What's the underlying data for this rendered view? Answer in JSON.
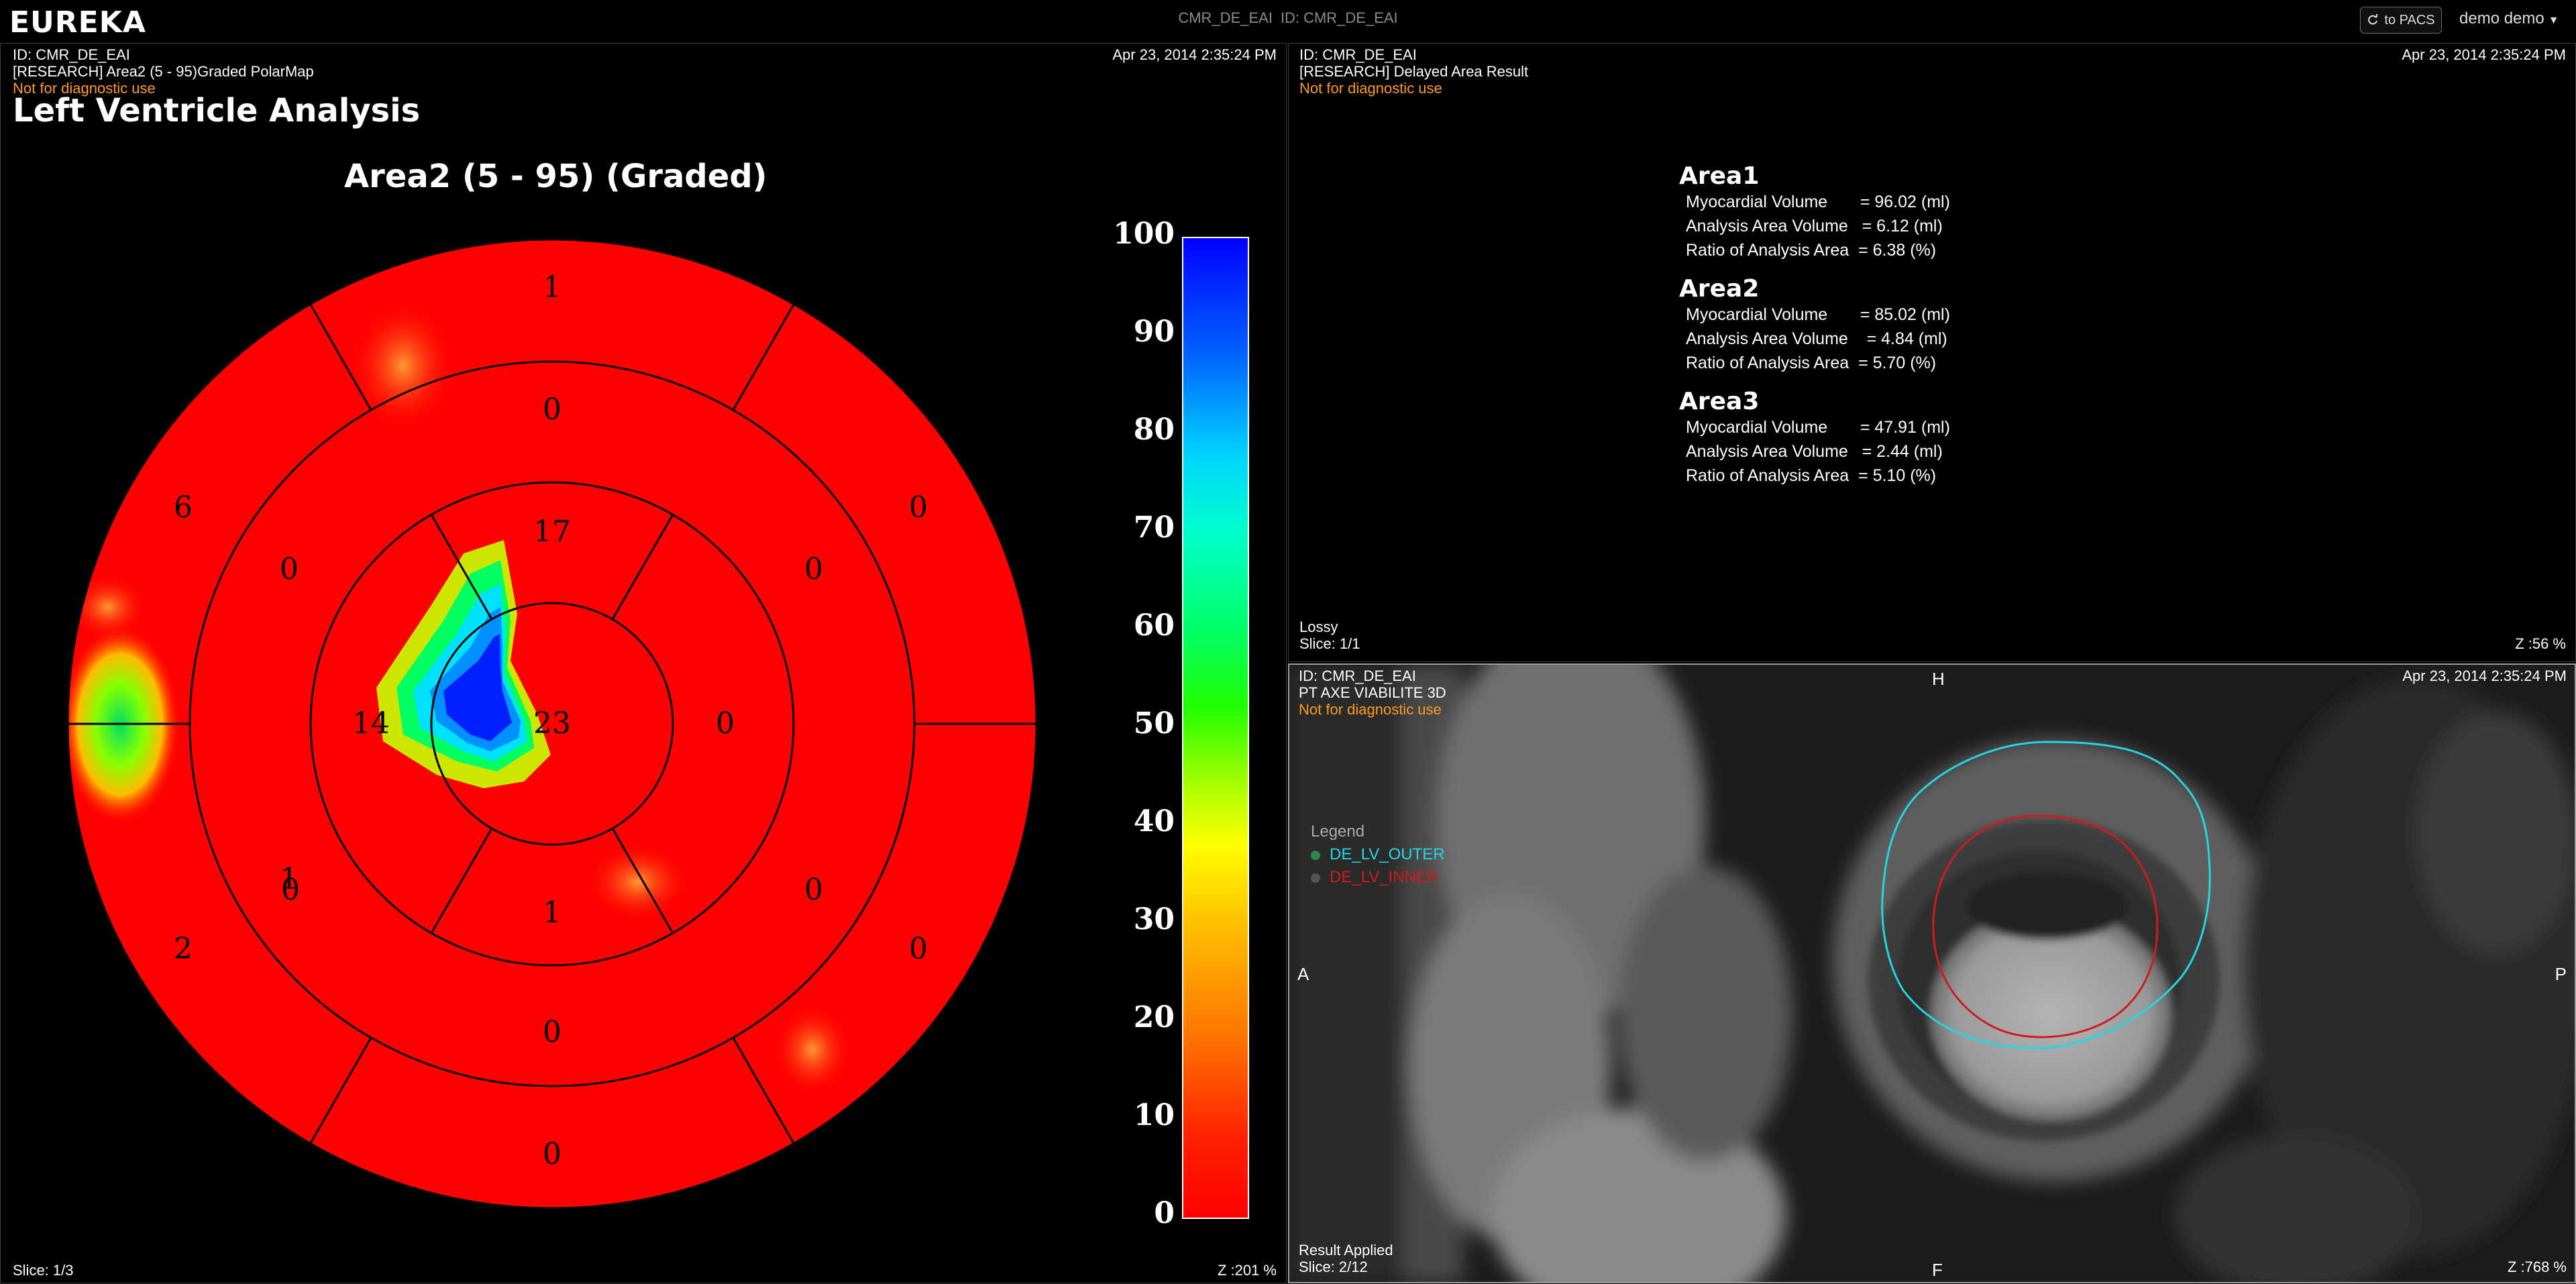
{
  "app": {
    "logo": "EUREKA",
    "study_id_label": "CMR_DE_EAI",
    "study_id_prefix": "ID:",
    "study_id_value": "CMR_DE_EAI"
  },
  "topbar": {
    "pacs_button": "to PACS",
    "user": "demo demo"
  },
  "left_panel": {
    "id": "ID: CMR_DE_EAI",
    "series": "[RESEARCH] Area2 (5 - 95)Graded PolarMap",
    "warning": "Not for diagnostic use",
    "date": "Apr 23, 2014 2:35:24 PM",
    "title": "Left Ventricle Analysis",
    "map_title": "Area2 (5 - 95) (Graded)",
    "slice": "Slice: 1/3",
    "zoom": "Z :201 %",
    "segments": [
      "1",
      "0",
      "17",
      "0",
      "0",
      "0",
      "23",
      "0",
      "0",
      "1",
      "0",
      "14",
      "0",
      "1",
      "2",
      "6",
      "0"
    ],
    "colorbar_ticks": [
      "100",
      "90",
      "80",
      "70",
      "60",
      "50",
      "40",
      "30",
      "20",
      "10",
      "0"
    ]
  },
  "top_right_panel": {
    "id": "ID: CMR_DE_EAI",
    "series": "[RESEARCH] Delayed Area Result",
    "warning": "Not for diagnostic use",
    "date": "Apr 23, 2014 2:35:24 PM",
    "compression": "Lossy",
    "slice": "Slice: 1/1",
    "zoom": "Z :56 %",
    "areas": [
      {
        "name": "Area1",
        "rows": [
          "Myocardial Volume       = 96.02 (ml)",
          "Analysis Area Volume   = 6.12 (ml)",
          "Ratio of Analysis Area  = 6.38 (%)"
        ]
      },
      {
        "name": "Area2",
        "rows": [
          "Myocardial Volume       = 85.02 (ml)",
          "Analysis Area Volume    = 4.84 (ml)",
          "Ratio of Analysis Area  = 5.70 (%)"
        ]
      },
      {
        "name": "Area3",
        "rows": [
          "Myocardial Volume       = 47.91 (ml)",
          "Analysis Area Volume   = 2.44 (ml)",
          "Ratio of Analysis Area  = 5.10 (%)"
        ]
      }
    ]
  },
  "bottom_right_panel": {
    "id": "ID: CMR_DE_EAI",
    "series": "PT AXE VIABILITE 3D",
    "warning": "Not for diagnostic use",
    "date": "Apr 23, 2014 2:35:24 PM",
    "legend_title": "Legend",
    "legend_items": [
      "DE_LV_OUTER",
      "DE_LV_INNER"
    ],
    "orientation": {
      "top": "H",
      "bottom": "F",
      "left": "A",
      "right": "P"
    },
    "status": "Result Applied",
    "slice": "Slice: 2/12",
    "zoom": "Z :768 %"
  },
  "colors": {
    "warning": "#ff9a1f",
    "outer_contour": "#22d6e6",
    "inner_contour": "#d11a1a"
  }
}
